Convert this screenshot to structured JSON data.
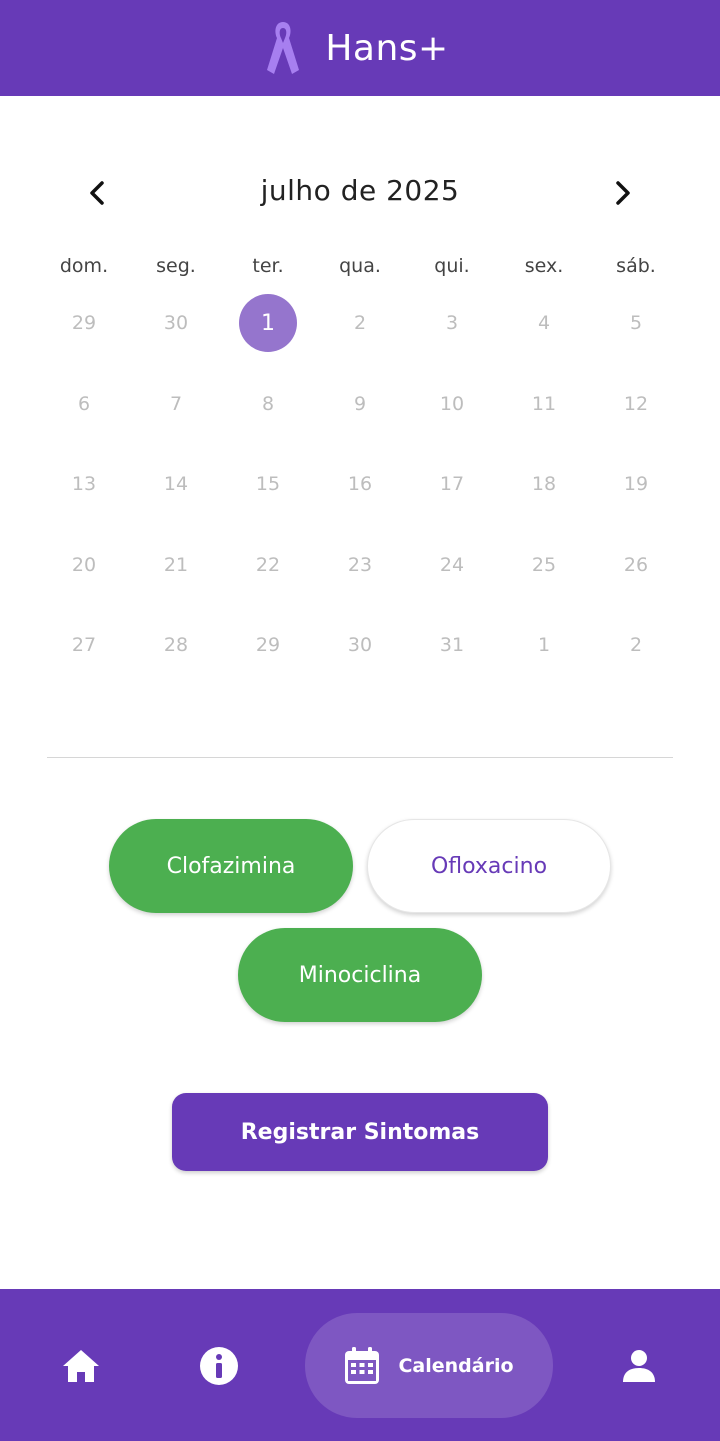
{
  "header": {
    "app_title": "Hans+",
    "ribbon_color": "#a77ff0"
  },
  "calendar": {
    "month_label": "julho de 2025",
    "prev_icon": "chevron-left-icon",
    "next_icon": "chevron-right-icon",
    "weekdays": [
      "dom.",
      "seg.",
      "ter.",
      "qua.",
      "qui.",
      "sex.",
      "sáb."
    ],
    "weeks": [
      [
        "29",
        "30",
        "1",
        "2",
        "3",
        "4",
        "5"
      ],
      [
        "6",
        "7",
        "8",
        "9",
        "10",
        "11",
        "12"
      ],
      [
        "13",
        "14",
        "15",
        "16",
        "17",
        "18",
        "19"
      ],
      [
        "20",
        "21",
        "22",
        "23",
        "24",
        "25",
        "26"
      ],
      [
        "27",
        "28",
        "29",
        "30",
        "31",
        "1",
        "2"
      ]
    ],
    "selected_day": "1",
    "selected_color": "#9575cd"
  },
  "medications": [
    {
      "label": "Clofazimina",
      "taken": true
    },
    {
      "label": "Ofloxacino",
      "taken": false
    },
    {
      "label": "Minociclina",
      "taken": true
    }
  ],
  "register_button_label": "Registrar Sintomas",
  "bottom_nav": {
    "home_icon": "home-icon",
    "info_icon": "info-icon",
    "calendar_icon": "calendar-icon",
    "calendar_label": "Calendário",
    "profile_icon": "user-icon"
  },
  "colors": {
    "primary": "#673ab7",
    "green": "#4caf50",
    "active_nav": "#7e57c2"
  }
}
